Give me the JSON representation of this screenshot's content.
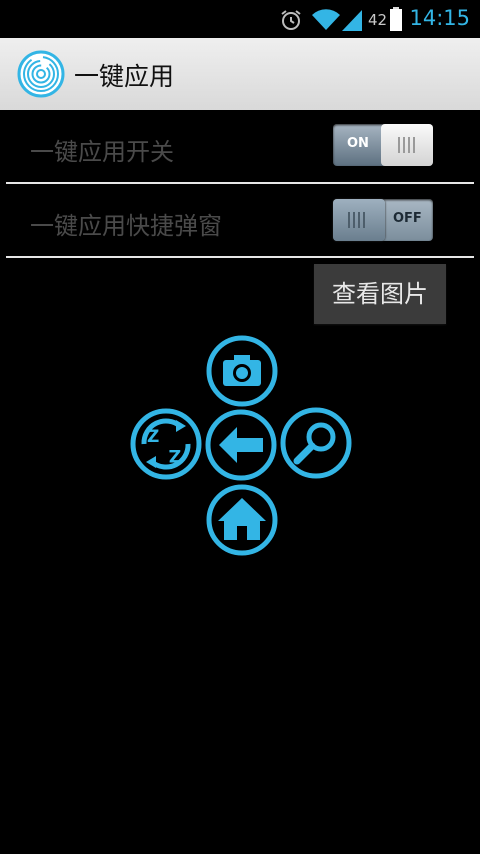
{
  "status_bar": {
    "time": "14:15",
    "battery_level": "42",
    "icons": [
      "alarm-icon",
      "wifi-icon",
      "signal-icon",
      "battery-icon"
    ]
  },
  "app": {
    "title": "一键应用",
    "logo_icon": "fingerprint-icon"
  },
  "settings": [
    {
      "label": "一键应用开关",
      "state_label": "ON",
      "enabled": true
    },
    {
      "label": "一键应用快捷弹窗",
      "state_label": "OFF",
      "enabled": false
    }
  ],
  "view_images_label": "查看图片",
  "quick_actions": [
    {
      "name": "camera",
      "icon": "camera-icon"
    },
    {
      "name": "rotate",
      "icon": "rotate-icon"
    },
    {
      "name": "back",
      "icon": "back-arrow-icon"
    },
    {
      "name": "search",
      "icon": "search-icon"
    },
    {
      "name": "home",
      "icon": "home-icon"
    }
  ],
  "colors": {
    "accent": "#33b5e5",
    "action_bar": "#e6e6e6",
    "background": "#000000"
  }
}
